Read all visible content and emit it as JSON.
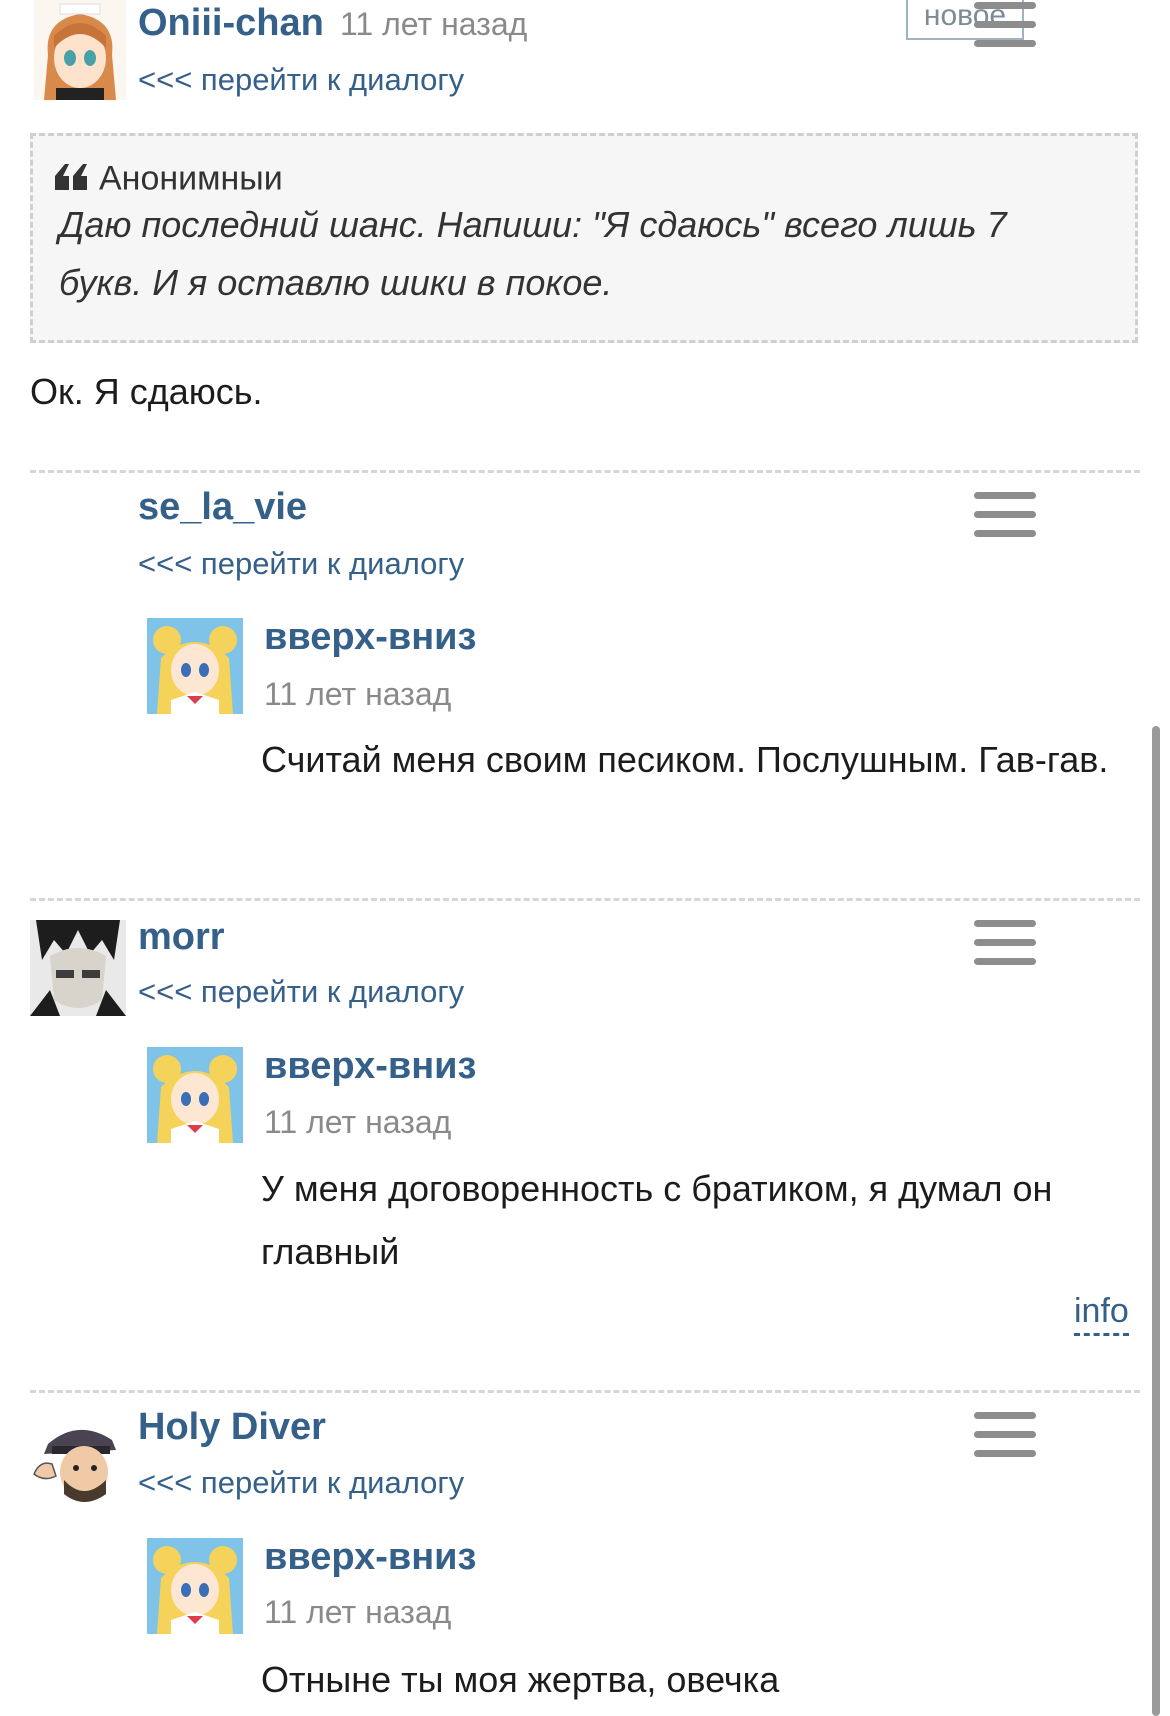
{
  "comments": [
    {
      "author": "Oniii-chan",
      "time": "11 лет назад",
      "badge": "новое",
      "dialog_link": "<<< перейти к диалогу",
      "quote": {
        "author": "Анонимныи",
        "text": "Даю последний шанс. Напиши: \"Я сдаюсь\" всего лишь 7 букв. И я оставлю шики в покое."
      },
      "text": "Ок. Я сдаюсь."
    },
    {
      "author": "se_la_vie",
      "dialog_link": "<<< перейти к диалогу",
      "reply": {
        "author": "вверх-вниз",
        "time": "11 лет назад",
        "text": "Считай меня своим песиком. Послушным. Гав-гав."
      }
    },
    {
      "author": "morr",
      "dialog_link": "<<< перейти к диалогу",
      "reply": {
        "author": "вверх-вниз",
        "time": "11 лет назад",
        "text": "У меня договоренность с братиком, я думал он главный"
      },
      "info_link": "info"
    },
    {
      "author": "Holy Diver",
      "dialog_link": "<<< перейти к диалогу",
      "reply": {
        "author": "вверх-вниз",
        "time": "11 лет назад",
        "text": "Отныне ты моя жертва, овечка"
      }
    }
  ],
  "icons": {
    "menu": "hamburger-menu-icon",
    "quote": "quote-marks-icon"
  }
}
